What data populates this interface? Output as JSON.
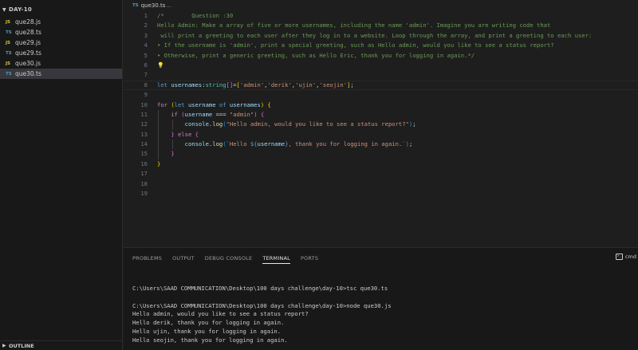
{
  "sidebar": {
    "folder": "DAY-10",
    "files": [
      {
        "badge": "JS",
        "name": "que28.js",
        "type": "js"
      },
      {
        "badge": "TS",
        "name": "que28.ts",
        "type": "ts"
      },
      {
        "badge": "JS",
        "name": "que29.js",
        "type": "js"
      },
      {
        "badge": "TS",
        "name": "que29.ts",
        "type": "ts"
      },
      {
        "badge": "JS",
        "name": "que30.js",
        "type": "js"
      },
      {
        "badge": "TS",
        "name": "que30.ts",
        "type": "ts"
      }
    ],
    "outline": "OUTLINE"
  },
  "editor": {
    "tab": {
      "badge": "TS",
      "name": "que30.ts",
      "breadcrumb": "..."
    },
    "line_numbers": [
      "1",
      "2",
      "3",
      "4",
      "5",
      "6",
      "7",
      "8",
      "9",
      "10",
      "11",
      "12",
      "13",
      "14",
      "15",
      "16",
      "17",
      "18",
      "19"
    ],
    "code": {
      "l1": "/*        Question :30",
      "l2": "Hello Admin: Make a array of five or more usernames, including the name 'admin'. Imagine you are writing code that",
      "l3": " will print a greeting to each user after they log in to a website. Loop through the array, and print a greeting to each user:",
      "l4": "• If the username is 'admin', print a special greeting, such as Hello admin, would you like to see a status report?",
      "l5": "• Otherwise, print a generic greeting, such as Hello Eric, thank you for logging in again.*/",
      "l6_bulb": "💡",
      "l8": {
        "kw": "let",
        "var": "usernames",
        "colon": ":",
        "type": "string",
        "arr_open": "[",
        "arr_close": "]",
        "eq": "=",
        "br_open": "[",
        "s1": "'admin'",
        "c1": ",",
        "s2": "'derik'",
        "c2": ",",
        "s3": "'ujin'",
        "c3": ",",
        "s4": "'seojin'",
        "br_close": "]",
        "semi": ";"
      },
      "l10": {
        "for": "for",
        "p_open": "(",
        "let": "let",
        "v": "username",
        "of": "of",
        "arr": "usernames",
        "p_close": ")",
        "brace": "{"
      },
      "l11": {
        "if": "if",
        "p_open": "(",
        "v": "username",
        "op": "===",
        "str": "\"admin\"",
        "p_close": ")",
        "brace": "{"
      },
      "l12": {
        "obj": "console",
        "dot": ".",
        "fn": "log",
        "p_open": "(",
        "str": "\"Hello admin, would you like to see a status report?\"",
        "p_close": ")",
        "semi": ";"
      },
      "l13": {
        "brace_close": "}",
        "else": "else",
        "brace_open": "{"
      },
      "l14": {
        "obj": "console",
        "dot": ".",
        "fn": "log",
        "p_open": "(",
        "str1": "`Hello ",
        "tpl_open": "${",
        "tpl_var": "username",
        "tpl_close": "}",
        "str2": ", thank you for logging in again.`",
        "p_close": ")",
        "semi": ";"
      },
      "l15": {
        "brace_close": "}"
      },
      "l16": {
        "brace_close": "}"
      }
    }
  },
  "panel": {
    "tabs": [
      "PROBLEMS",
      "OUTPUT",
      "DEBUG CONSOLE",
      "TERMINAL",
      "PORTS"
    ],
    "active_tab": "TERMINAL",
    "shell": "cmd",
    "terminal_lines": [
      "C:\\Users\\SAAD COMMUNICATION\\Desktop\\100 days challenge\\day-10>tsc que30.ts",
      "",
      "C:\\Users\\SAAD COMMUNICATION\\Desktop\\100 days challenge\\day-10>node que30.js",
      "Hello admin, would you like to see a status report?",
      "Hello derik, thank you for logging in again.",
      "Hello ujin, thank you for logging in again.",
      "Hello seojin, thank you for logging in again."
    ]
  }
}
